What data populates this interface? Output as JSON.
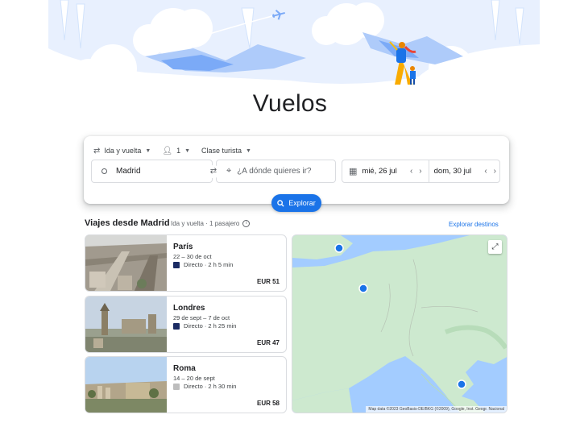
{
  "page": {
    "title": "Vuelos"
  },
  "search": {
    "trip_type": "Ida y vuelta",
    "passengers": "1",
    "cabin_class": "Clase turista",
    "origin": "Madrid",
    "destination_placeholder": "¿A dónde quieres ir?",
    "depart_date": "mié, 26 jul",
    "return_date": "dom, 30 jul",
    "explore_button": "Explorar"
  },
  "section": {
    "title": "Viajes desde Madrid",
    "subtitle": "Ida y vuelta · 1 pasajero",
    "explore_link": "Explorar destinos"
  },
  "destinations": [
    {
      "name": "París",
      "dates": "22 – 30 de oct",
      "flight": "Directo · 2 h 5 min",
      "price": "EUR 51",
      "airline_color": "#1c2c64"
    },
    {
      "name": "Londres",
      "dates": "29 de sept – 7 de oct",
      "flight": "Directo · 2 h 25 min",
      "price": "EUR 47",
      "airline_color": "#1c2c64"
    },
    {
      "name": "Roma",
      "dates": "14 – 20 de sept",
      "flight": "Directo · 2 h 30 min",
      "price": "EUR 58",
      "airline_color": "#bdbdbd"
    }
  ],
  "map": {
    "attribution": "Map data ©2023 GeoBasis-DE/BKG (©2009), Google, Inst. Geogr. Nacional"
  },
  "colors": {
    "accent": "#1a73e8",
    "map_water": "#a3ccff",
    "map_land": "#cde9cf"
  }
}
